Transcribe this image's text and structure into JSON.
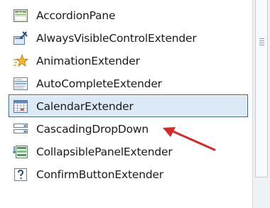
{
  "toolbox": {
    "items": [
      {
        "label": "AccordionPane",
        "icon": "accordion-pane-icon"
      },
      {
        "label": "AlwaysVisibleControlExtender",
        "icon": "pin-icon"
      },
      {
        "label": "AnimationExtender",
        "icon": "animation-star-icon"
      },
      {
        "label": "AutoCompleteExtender",
        "icon": "autocomplete-list-icon"
      },
      {
        "label": "CalendarExtender",
        "icon": "calendar-icon",
        "selected": true
      },
      {
        "label": "CascadingDropDown",
        "icon": "dropdown-icon"
      },
      {
        "label": "CollapsiblePanelExtender",
        "icon": "collapsible-panel-icon"
      },
      {
        "label": "ConfirmButtonExtender",
        "icon": "confirm-question-icon"
      }
    ]
  },
  "colors": {
    "selection_fill": "#dce9f7",
    "selection_border": "#3e5f8a",
    "annotation_arrow": "#d42a2a"
  }
}
